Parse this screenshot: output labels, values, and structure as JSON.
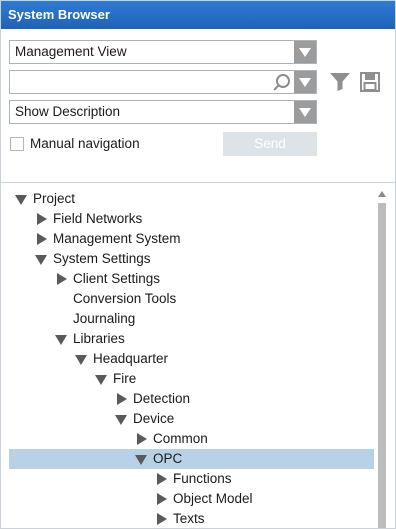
{
  "window": {
    "title": "System Browser"
  },
  "controls": {
    "view_select": "Management View",
    "search_value": "",
    "description_select": "Show Description",
    "manual_navigation_label": "Manual navigation",
    "manual_navigation_checked": false,
    "send_label": "Send"
  },
  "icons": {
    "filter": "filter-icon",
    "save": "save-icon",
    "search": "search-icon"
  },
  "colors": {
    "title_bar": "#1f63b8",
    "selection": "#b9d1e6",
    "dropdown_caret": "#9c9c9c",
    "send_disabled": "#dee3e7"
  },
  "tree": [
    {
      "label": "Project",
      "level": 0,
      "state": "expanded"
    },
    {
      "label": "Field Networks",
      "level": 1,
      "state": "collapsed"
    },
    {
      "label": "Management System",
      "level": 1,
      "state": "collapsed"
    },
    {
      "label": "System Settings",
      "level": 1,
      "state": "expanded"
    },
    {
      "label": "Client Settings",
      "level": 2,
      "state": "collapsed"
    },
    {
      "label": "Conversion Tools",
      "level": 2,
      "state": "leaf"
    },
    {
      "label": "Journaling",
      "level": 2,
      "state": "leaf"
    },
    {
      "label": "Libraries",
      "level": 2,
      "state": "expanded"
    },
    {
      "label": "Headquarter",
      "level": 3,
      "state": "expanded"
    },
    {
      "label": "Fire",
      "level": 4,
      "state": "expanded"
    },
    {
      "label": "Detection",
      "level": 5,
      "state": "collapsed"
    },
    {
      "label": "Device",
      "level": 5,
      "state": "expanded"
    },
    {
      "label": "Common",
      "level": 6,
      "state": "collapsed"
    },
    {
      "label": "OPC",
      "level": 6,
      "state": "expanded",
      "selected": true
    },
    {
      "label": "Functions",
      "level": 7,
      "state": "collapsed"
    },
    {
      "label": "Object Model",
      "level": 7,
      "state": "collapsed"
    },
    {
      "label": "Texts",
      "level": 7,
      "state": "collapsed"
    }
  ]
}
